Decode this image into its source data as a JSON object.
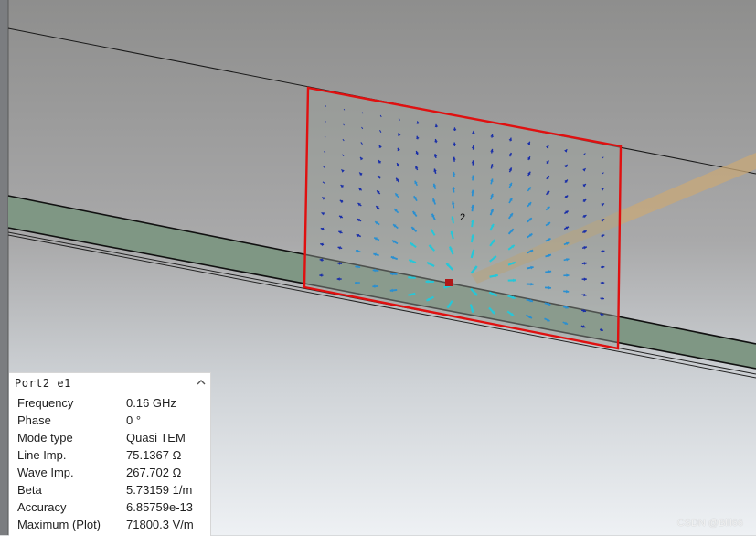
{
  "scene": {
    "port_label": "2",
    "colors": {
      "background_top": "#8f8f8e",
      "background_bottom": "#eef1f4",
      "port_outline": "#e01010",
      "substrate": "#7f9784",
      "line_trace": "#c8a878",
      "arrow_weak": "#1a2fa8",
      "arrow_strong": "#26c7d8",
      "arrow_mid": "#2a8fd0"
    }
  },
  "info_panel": {
    "title": "Port2 e1",
    "collapse_icon": "chevron-up-icon",
    "rows": [
      {
        "label": "Frequency",
        "value": "0.16 GHz"
      },
      {
        "label": "Phase",
        "value": "0 °"
      },
      {
        "label": "Mode type",
        "value": "Quasi TEM"
      },
      {
        "label": "Line Imp.",
        "value": "75.1367 Ω"
      },
      {
        "label": "Wave Imp.",
        "value": "267.702 Ω"
      },
      {
        "label": "Beta",
        "value": "5.73159 1/m"
      },
      {
        "label": "Accuracy",
        "value": "6.85759e-13"
      },
      {
        "label": "Maximum (Plot)",
        "value": "71800.3 V/m"
      }
    ]
  },
  "watermark": "CSDN @Bill66"
}
